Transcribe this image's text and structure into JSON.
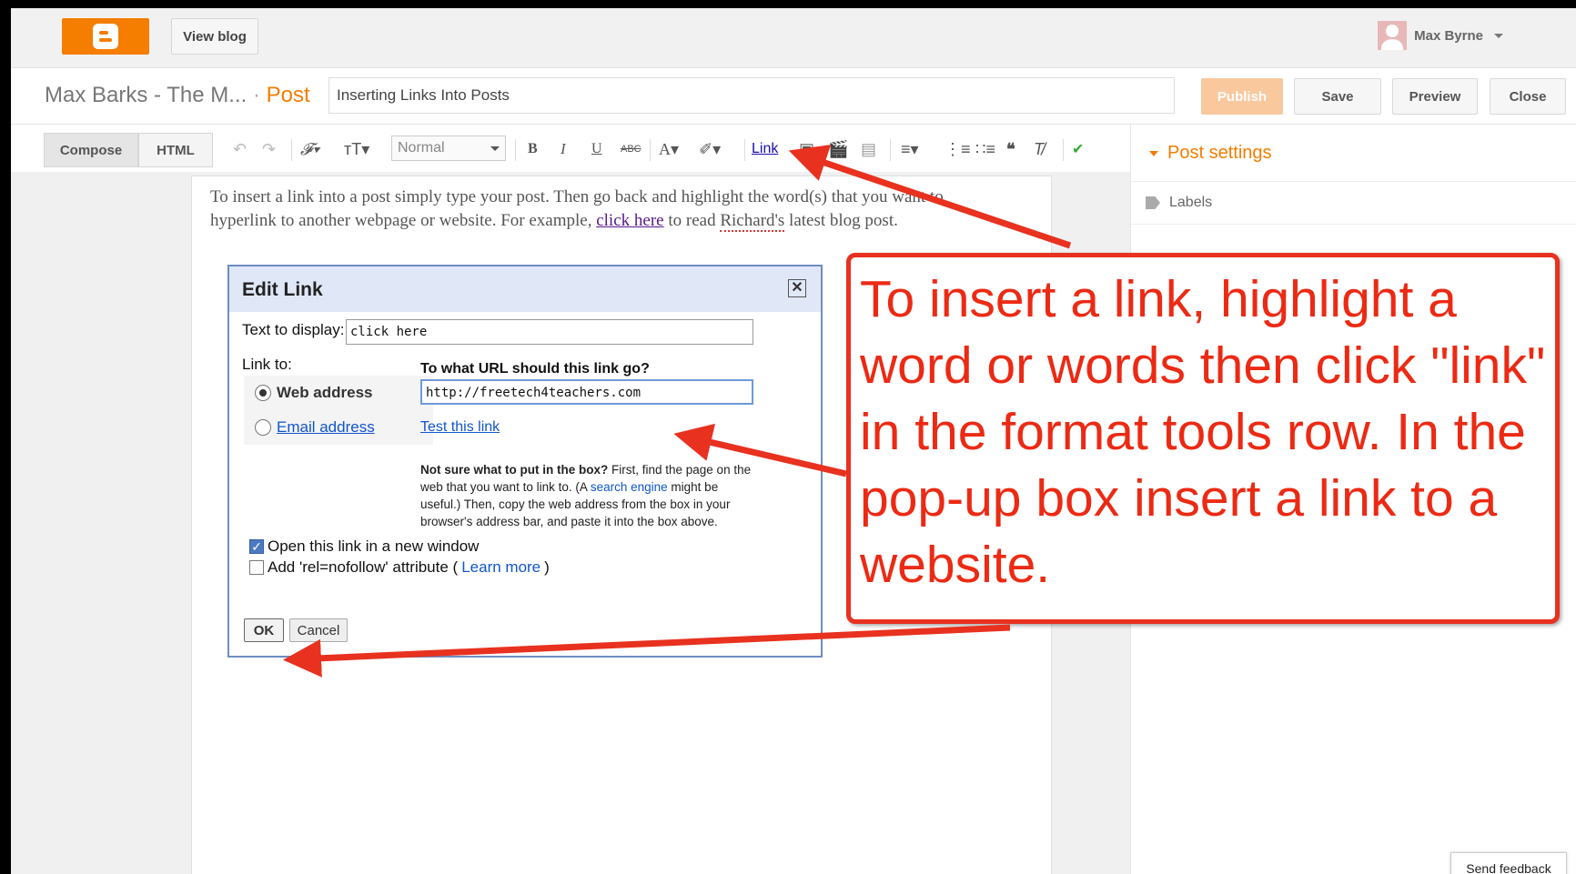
{
  "topbar": {
    "view_blog": "View blog",
    "user_name": "Max Byrne"
  },
  "titlebar": {
    "blog_name": "Max Barks - The M...",
    "separator": "·",
    "crumb": "Post",
    "post_title": "Inserting Links Into Posts",
    "publish": "Publish",
    "save": "Save",
    "preview": "Preview",
    "close": "Close"
  },
  "toolbar": {
    "compose": "Compose",
    "html": "HTML",
    "format": "Normal",
    "bold": "B",
    "italic": "I",
    "underline": "U",
    "strike": "ABC",
    "link": "Link"
  },
  "sidebar": {
    "post_settings": "Post settings",
    "labels": "Labels"
  },
  "editor": {
    "text_before": "To insert a link into a post simply type your post. Then go back and highlight the word(s) that you want to hyperlink to another webpage or website. For example, ",
    "link_text": "click here",
    "text_middle": " to read ",
    "spell_word": "Richard's",
    "text_after": " latest blog post."
  },
  "dialog": {
    "title": "Edit Link",
    "close": "✕",
    "text_to_display_label": "Text to display:",
    "text_to_display_value": "click here",
    "link_to_label": "Link to:",
    "web_address": "Web address",
    "email_address": "Email address",
    "url_question": "To what URL should this link go?",
    "url_value": "http://freetech4teachers.com",
    "test_link": "Test this link",
    "help_bold": "Not sure what to put in the box?",
    "help_1": " First, find the page on the web that you want to link to. (A ",
    "help_link": "search engine",
    "help_2": " might be useful.) Then, copy the web address from the box in your browser's address bar, and paste it into the box above.",
    "open_new_window": "Open this link in a new window",
    "nofollow_prefix": "Add 'rel=nofollow' attribute (",
    "learn_more": "Learn more",
    "nofollow_suffix": ")",
    "ok": "OK",
    "cancel": "Cancel"
  },
  "callout": {
    "text": "To insert a link, highlight a word or words then click \"link\" in the format tools row. In the pop-up box insert a link to a website.",
    "color": "#ec2a14"
  },
  "footer": {
    "send_feedback": "Send feedback"
  },
  "colors": {
    "brand": "#f57d00",
    "annotation_red": "#e8311f"
  }
}
